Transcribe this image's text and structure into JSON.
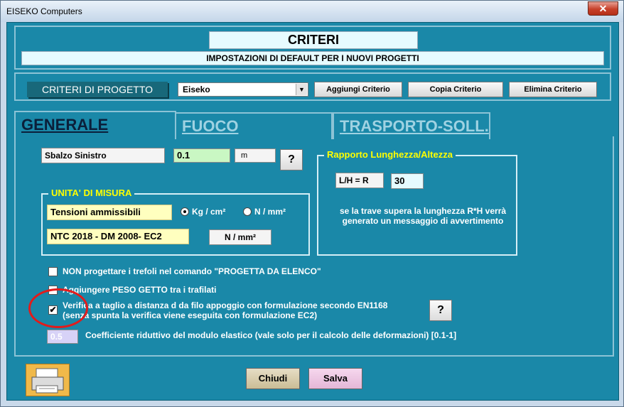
{
  "window": {
    "title": "EISEKO Computers",
    "close_label": "✕"
  },
  "header": {
    "title": "CRITERI",
    "subtitle": "IMPOSTAZIONI DI DEFAULT PER I NUOVI PROGETTI"
  },
  "criteria": {
    "label": "CRITERI DI PROGETTO",
    "selected": "Eiseko",
    "add_label": "Aggiungi Criterio",
    "copy_label": "Copia Criterio",
    "delete_label": "Elimina Criterio"
  },
  "tabs": [
    {
      "label": "GENERALE",
      "active": true
    },
    {
      "label": "FUOCO",
      "active": false
    },
    {
      "label": "TRASPORTO-SOLL.",
      "active": false
    }
  ],
  "sbalzo": {
    "label": "Sbalzo Sinistro",
    "value": "0.1",
    "unit": "m",
    "help": "?"
  },
  "rapporto": {
    "title": "Rapporto Lunghezza/Altezza",
    "label": "L/H = R",
    "value": "30",
    "note": "se la trave supera la lunghezza R*H verrà generato un messaggio di avvertimento"
  },
  "unita": {
    "title": "UNITA' DI MISURA",
    "tensioni_label": "Tensioni ammissibili",
    "option1": "Kg / cm²",
    "option2": "N / mm²",
    "selected_index": 0,
    "ntc_label": "NTC 2018 - DM 2008- EC2",
    "ntc_unit": "N / mm²"
  },
  "options": {
    "trefoli": {
      "label": "NON progettare i trefoli nel comando \"PROGETTA DA ELENCO\"",
      "checked": false
    },
    "peso_getto": {
      "label": "Aggiungere PESO GETTO tra i trafilati",
      "checked": false
    },
    "verifica": {
      "line1": "Verifica a taglio a distanza  d da filo appoggio con formulazione secondo EN1168",
      "line2": "(senza spunta la verifica viene eseguita con formulazione EC2)",
      "checked": true,
      "check_mark": "✔",
      "help": "?"
    },
    "coefficiente": {
      "value": "0.5",
      "label": "Coefficiente riduttivo del modulo elastico (vale solo per il calcolo delle deformazioni) [0.1-1]"
    }
  },
  "footer": {
    "chiudi_label": "Chiudi",
    "salva_label": "Salva",
    "printer_icon": "printer-icon"
  },
  "colors": {
    "background": "#1a88a8",
    "group_title": "#ffff00",
    "annotation": "#e21b1b"
  }
}
